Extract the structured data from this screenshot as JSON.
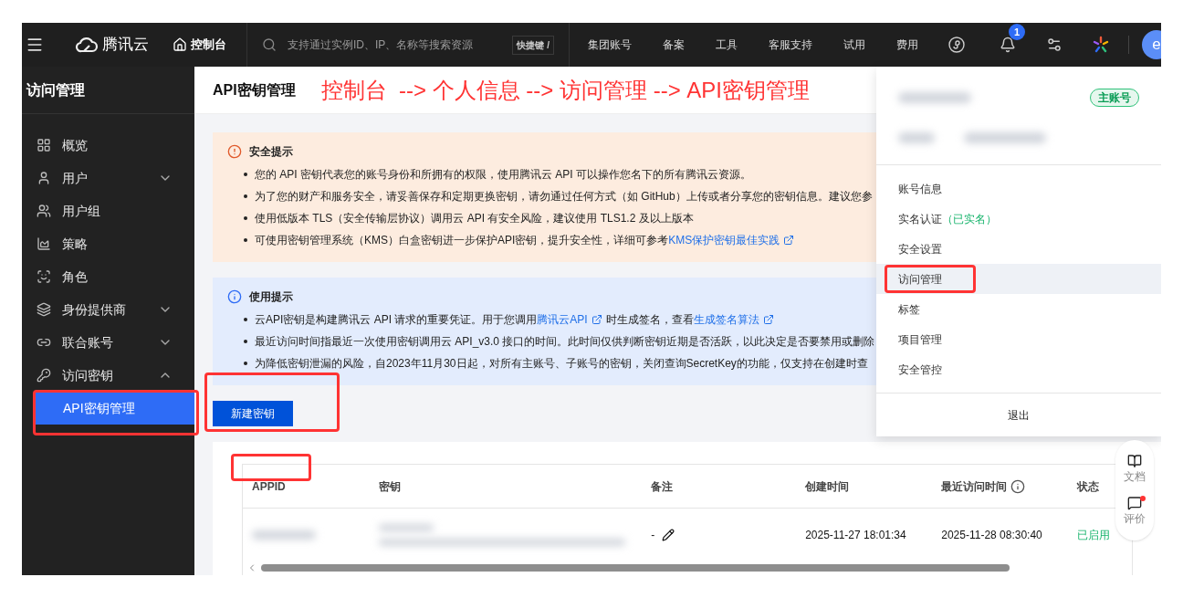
{
  "top_bar": {
    "brand": "腾讯云",
    "console": "控制台",
    "search": {
      "placeholder": "支持通过实例ID、IP、名称等搜索资源"
    },
    "shortcut": "快捷键 /",
    "nav": [
      "集团账号",
      "备案",
      "工具",
      "客服支持",
      "试用",
      "费用"
    ],
    "notification_count": "1",
    "avatar": "e"
  },
  "sidebar": {
    "title": "访问管理",
    "items": [
      {
        "label": "概览",
        "kind": "link",
        "selected": false
      },
      {
        "label": "用户",
        "kind": "group",
        "expanded": false,
        "selected": false
      },
      {
        "label": "用户组",
        "kind": "link",
        "selected": false
      },
      {
        "label": "策略",
        "kind": "link",
        "selected": false
      },
      {
        "label": "角色",
        "kind": "link",
        "selected": false
      },
      {
        "label": "身份提供商",
        "kind": "group",
        "expanded": false,
        "selected": false
      },
      {
        "label": "联合账号",
        "kind": "group",
        "expanded": false,
        "selected": false
      },
      {
        "label": "访问密钥",
        "kind": "group",
        "expanded": true,
        "selected": false,
        "children": [
          {
            "label": "API密钥管理",
            "selected": true
          }
        ]
      }
    ]
  },
  "page_title": "API密钥管理",
  "annotation": "控制台  --> 个人信息 --> 访问管理 --> API密钥管理",
  "alerts": [
    {
      "kind": "warning",
      "title": "安全提示",
      "lines": [
        [
          {
            "text": "您的 API 密钥代表您的账号身份和所拥有的权限，使用腾讯云 API 可以操作您名下的所有腾讯云资源。"
          }
        ],
        [
          {
            "text": "为了您的财产和服务安全，请妥善保存和定期更换密钥，请勿通过任何方式（如 GitHub）上传或者分享您的密钥信息。建议您参"
          }
        ],
        [
          {
            "text": "使用低版本 TLS（安全传输层协议）调用云 API 有安全风险，建议使用 TLS1.2 及以上版本"
          }
        ],
        [
          {
            "text": "可使用密钥管理系统（KMS）白盒密钥进一步保护API密钥，提升安全性，详细可参考"
          },
          {
            "text": "KMS保护密钥最佳实践",
            "link": true
          }
        ]
      ]
    },
    {
      "kind": "info",
      "title": "使用提示",
      "lines": [
        [
          {
            "text": "云API密钥是构建腾讯云 API 请求的重要凭证。用于您调用"
          },
          {
            "text": "腾讯云API",
            "link": true
          },
          {
            "text": "时生成签名，查看"
          },
          {
            "text": "生成签名算法",
            "link": true
          }
        ],
        [
          {
            "text": "最近访问时间指最近一次使用密钥调用云 API_v3.0 接口的时间。此时间仅供判断密钥近期是否活跃，以此决定是否要禁用或删除"
          }
        ],
        [
          {
            "text": "为降低密钥泄漏的风险，自2023年11月30日起，对所有主账号、子账号的密钥，关闭查询SecretKey的功能，仅支持在创建时查"
          }
        ]
      ]
    }
  ],
  "create_button": "新建密钥",
  "table": {
    "columns": [
      "APPID",
      "密钥",
      "备注",
      "创建时间",
      "最近访问时间",
      "状态"
    ],
    "rows": [
      {
        "note": "-",
        "created": "2025-11-27 18:01:34",
        "last_access": "2025-11-28 08:30:40",
        "status": "已启用",
        "enabled": true
      }
    ]
  },
  "account_menu": {
    "badge": "主账号",
    "items": [
      {
        "label": "账号信息",
        "selected": false
      },
      {
        "label": "实名认证",
        "note": "（已实名）",
        "selected": false
      },
      {
        "label": "安全设置",
        "selected": false
      },
      {
        "label": "访问管理",
        "selected": true
      },
      {
        "label": "标签",
        "selected": false
      },
      {
        "label": "项目管理",
        "selected": false
      },
      {
        "label": "安全管控",
        "selected": false
      }
    ],
    "logout": "退出"
  },
  "side_widget": [
    {
      "label": "文档",
      "dot": false
    },
    {
      "label": "评价",
      "dot": true
    }
  ]
}
